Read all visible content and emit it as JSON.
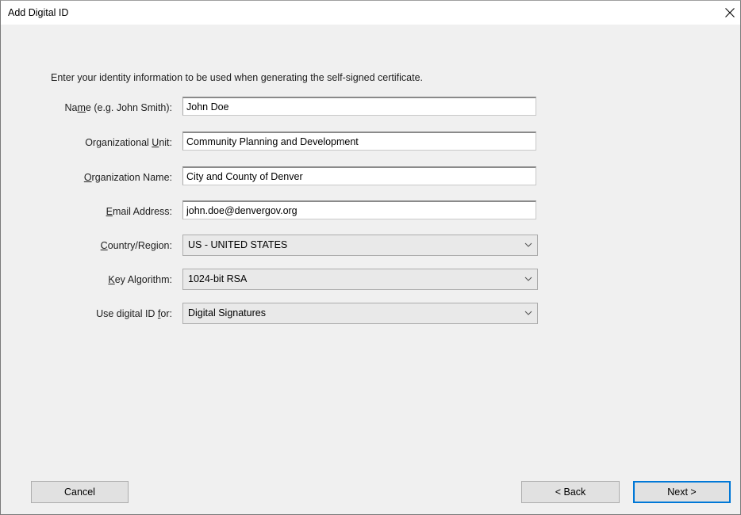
{
  "window": {
    "title": "Add Digital ID",
    "close_icon": "close-icon"
  },
  "instructions": "Enter your identity information to be used when generating the self-signed certificate.",
  "fields": {
    "name": {
      "label_pre": "Na",
      "label_mnemonic": "m",
      "label_post": "e (e.g. John Smith):",
      "value": "John Doe"
    },
    "org_unit": {
      "label_pre": "Organizational ",
      "label_mnemonic": "U",
      "label_post": "nit:",
      "value": "Community Planning and Development"
    },
    "org_name": {
      "label_pre": "",
      "label_mnemonic": "O",
      "label_post": "rganization Name:",
      "value": "City and County of Denver"
    },
    "email": {
      "label_pre": "",
      "label_mnemonic": "E",
      "label_post": "mail Address:",
      "value": "john.doe@denvergov.org"
    },
    "country": {
      "label_pre": "",
      "label_mnemonic": "C",
      "label_post": "ountry/Region:",
      "value": "US - UNITED STATES"
    },
    "key_algorithm": {
      "label_pre": "",
      "label_mnemonic": "K",
      "label_post": "ey Algorithm:",
      "value": "1024-bit RSA"
    },
    "use_for": {
      "label_pre": "Use digital ID ",
      "label_mnemonic": "f",
      "label_post": "or:",
      "value": "Digital Signatures"
    }
  },
  "buttons": {
    "cancel": "Cancel",
    "back": "< Back",
    "next": "Next >"
  },
  "colors": {
    "dialog_background": "#f0f0f0",
    "focus_accent": "#0078d7"
  }
}
